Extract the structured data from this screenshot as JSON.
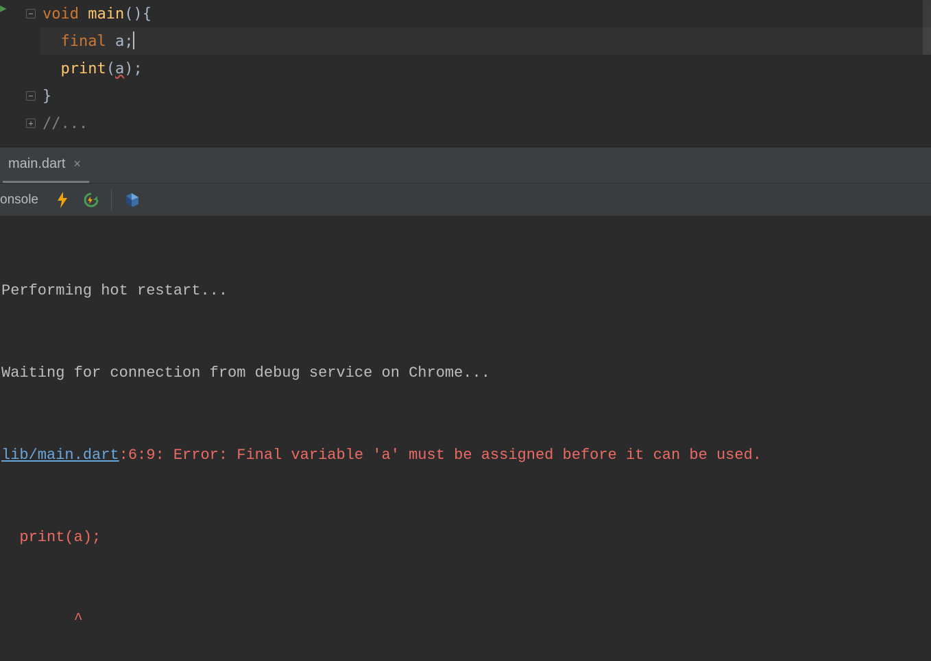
{
  "editor": {
    "lines": [
      {
        "indent": "",
        "tokens": [
          {
            "cls": "kw",
            "txt": "void"
          },
          {
            "cls": "punct",
            "txt": " "
          },
          {
            "cls": "fn",
            "txt": "main"
          },
          {
            "cls": "punct",
            "txt": "(){"
          }
        ],
        "fold": "-",
        "run": true
      },
      {
        "indent": "  ",
        "tokens": [
          {
            "cls": "kw",
            "txt": "final"
          },
          {
            "cls": "punct",
            "txt": " "
          },
          {
            "cls": "ident",
            "txt": "a"
          },
          {
            "cls": "punct",
            "txt": ";"
          }
        ],
        "caret": true,
        "current": true
      },
      {
        "indent": "  ",
        "tokens": [
          {
            "cls": "fn",
            "txt": "print"
          },
          {
            "cls": "punct",
            "txt": "("
          },
          {
            "cls": "ident err-underline",
            "txt": "a"
          },
          {
            "cls": "punct",
            "txt": ");"
          }
        ]
      },
      {
        "indent": "",
        "tokens": [
          {
            "cls": "punct",
            "txt": "}"
          }
        ],
        "fold": "-"
      },
      {
        "indent": "",
        "tokens": [
          {
            "cls": "comment",
            "txt": "//..."
          }
        ],
        "fold": "+"
      }
    ]
  },
  "tab": {
    "label": "main.dart",
    "close": "×"
  },
  "toolbar": {
    "console_label": "onsole"
  },
  "console": {
    "line1": "Performing hot restart...",
    "line2": "Waiting for connection from debug service on Chrome...",
    "err_link": "lib/main.dart",
    "err_loc": ":6:9: Error: Final variable 'a' must be assigned before it can be used.",
    "err_code": "  print(a);",
    "err_caret": "        ^"
  }
}
